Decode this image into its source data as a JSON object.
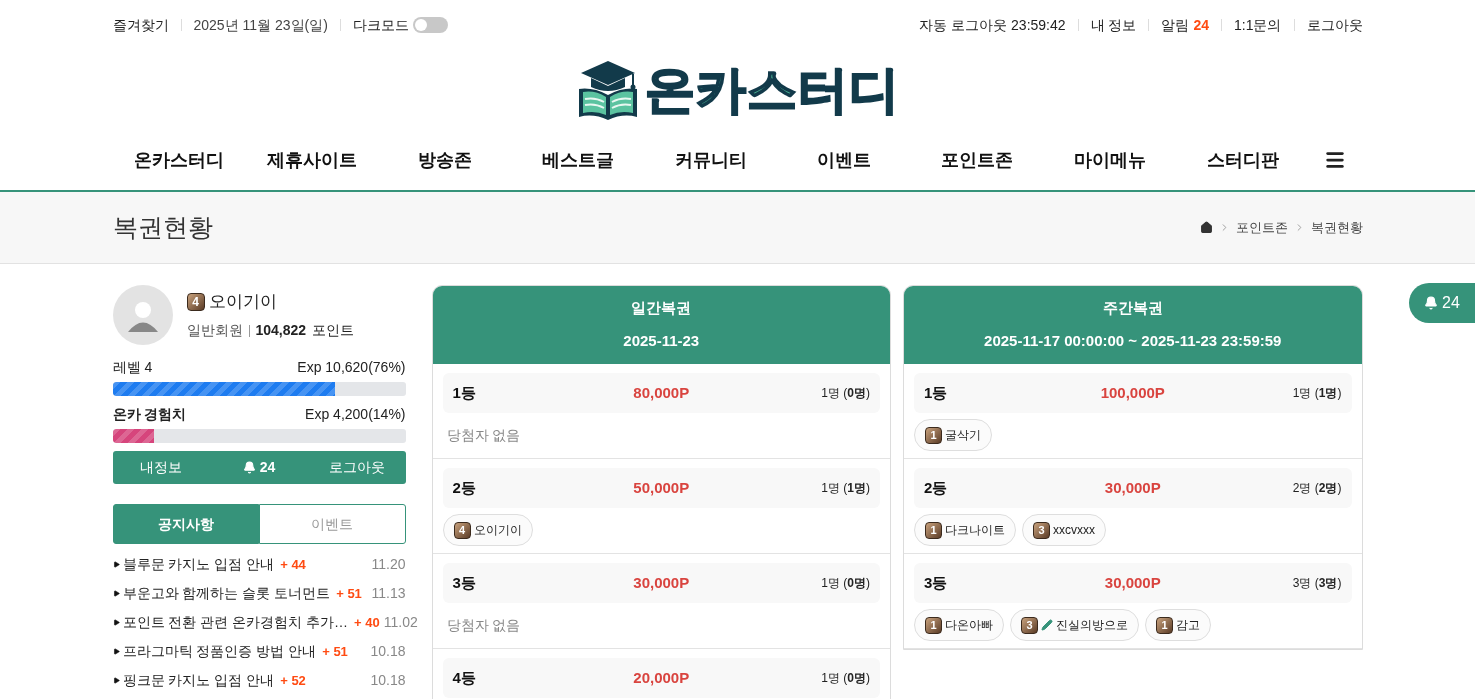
{
  "top_bar": {
    "left": [
      {
        "kind": "link",
        "label": "즐겨찾기"
      },
      {
        "kind": "text",
        "label": "2025년 11월 23일(일)"
      },
      {
        "kind": "toggle",
        "label": "다크모드",
        "on": false
      }
    ],
    "right": [
      {
        "label": "자동 로그아웃 23:59:42"
      },
      {
        "label": "내 정보"
      },
      {
        "label": "알림",
        "count": "24"
      },
      {
        "label": "1:1문의"
      },
      {
        "label": "로그아웃"
      }
    ]
  },
  "logo": {
    "text": "온카스터디"
  },
  "nav": [
    "온카스터디",
    "제휴사이트",
    "방송존",
    "베스트글",
    "커뮤니티",
    "이벤트",
    "포인트존",
    "마이메뉴",
    "스터디판"
  ],
  "page_title": "복권현황",
  "breadcrumb": [
    "포인트존",
    "복권현황"
  ],
  "profile": {
    "level_badge": "4",
    "name": "오이기이",
    "grade": "일반회원",
    "points": "104,822",
    "points_unit": "포인트",
    "meters": [
      {
        "label": "레벨 4",
        "reading": "Exp 10,620(76%)",
        "level": 0.76,
        "bold": false,
        "color": "#1e7cf0"
      },
      {
        "label": "온카 경험치",
        "reading": "Exp 4,200(14%)",
        "level": 0.14,
        "bold": true,
        "color": "#d6457c"
      }
    ],
    "actions": [
      {
        "kind": "text",
        "label": "내정보"
      },
      {
        "kind": "bell",
        "label": "24"
      },
      {
        "kind": "text",
        "label": "로그아웃"
      }
    ]
  },
  "tabs": [
    {
      "label": "공지사항",
      "selected": true
    },
    {
      "label": "이벤트",
      "selected": false
    }
  ],
  "notices": [
    {
      "title": "블루문 카지노 입점 안내",
      "plus": "+ 44",
      "date": "11.20"
    },
    {
      "title": "부운고와 함께하는 슬롯 토너먼트",
      "plus": "+ 51",
      "date": "11.13"
    },
    {
      "title": "포인트 전환 관련 온카경험치 추가…",
      "plus": "+ 40",
      "date": "11.02"
    },
    {
      "title": "프라그마틱 정품인증 방법 안내",
      "plus": "+ 51",
      "date": "10.18"
    },
    {
      "title": "핑크문 카지노 입점 안내",
      "plus": "+ 52",
      "date": "10.18"
    }
  ],
  "lotteries": [
    {
      "title": "일간복권",
      "period": "2025-11-23",
      "ranks": [
        {
          "rank": "1등",
          "prize": "80,000P",
          "count": "1명 (**0명**)",
          "empty_text": "당첨자 없음"
        },
        {
          "rank": "2등",
          "prize": "50,000P",
          "count": "1명 (**1명**)",
          "winners": [
            {
              "level": "4",
              "name": "오이기이",
              "pencil": false
            }
          ]
        },
        {
          "rank": "3등",
          "prize": "30,000P",
          "count": "1명 (**0명**)",
          "empty_text": "당첨자 없음"
        },
        {
          "rank": "4등",
          "prize": "20,000P",
          "count": "1명 (**0명**)"
        }
      ]
    },
    {
      "title": "주간복권",
      "period": "2025-11-17 00:00:00 ~ 2025-11-23 23:59:59",
      "ranks": [
        {
          "rank": "1등",
          "prize": "100,000P",
          "count": "1명 (**1명**)",
          "winners": [
            {
              "level": "1",
              "name": "굴삭기",
              "pencil": false
            }
          ]
        },
        {
          "rank": "2등",
          "prize": "30,000P",
          "count": "2명 (**2명**)",
          "winners": [
            {
              "level": "1",
              "name": "다크나이트",
              "pencil": false
            },
            {
              "level": "3",
              "name": "xxcvxxx",
              "pencil": false
            }
          ]
        },
        {
          "rank": "3등",
          "prize": "30,000P",
          "count": "3명 (**3명**)",
          "winners": [
            {
              "level": "1",
              "name": "다온아빠",
              "pencil": false
            },
            {
              "level": "3",
              "name": "진실의방으로",
              "pencil": true
            },
            {
              "level": "1",
              "name": "감고",
              "pencil": false
            }
          ]
        }
      ]
    }
  ],
  "floating_alert": {
    "count": "24"
  }
}
